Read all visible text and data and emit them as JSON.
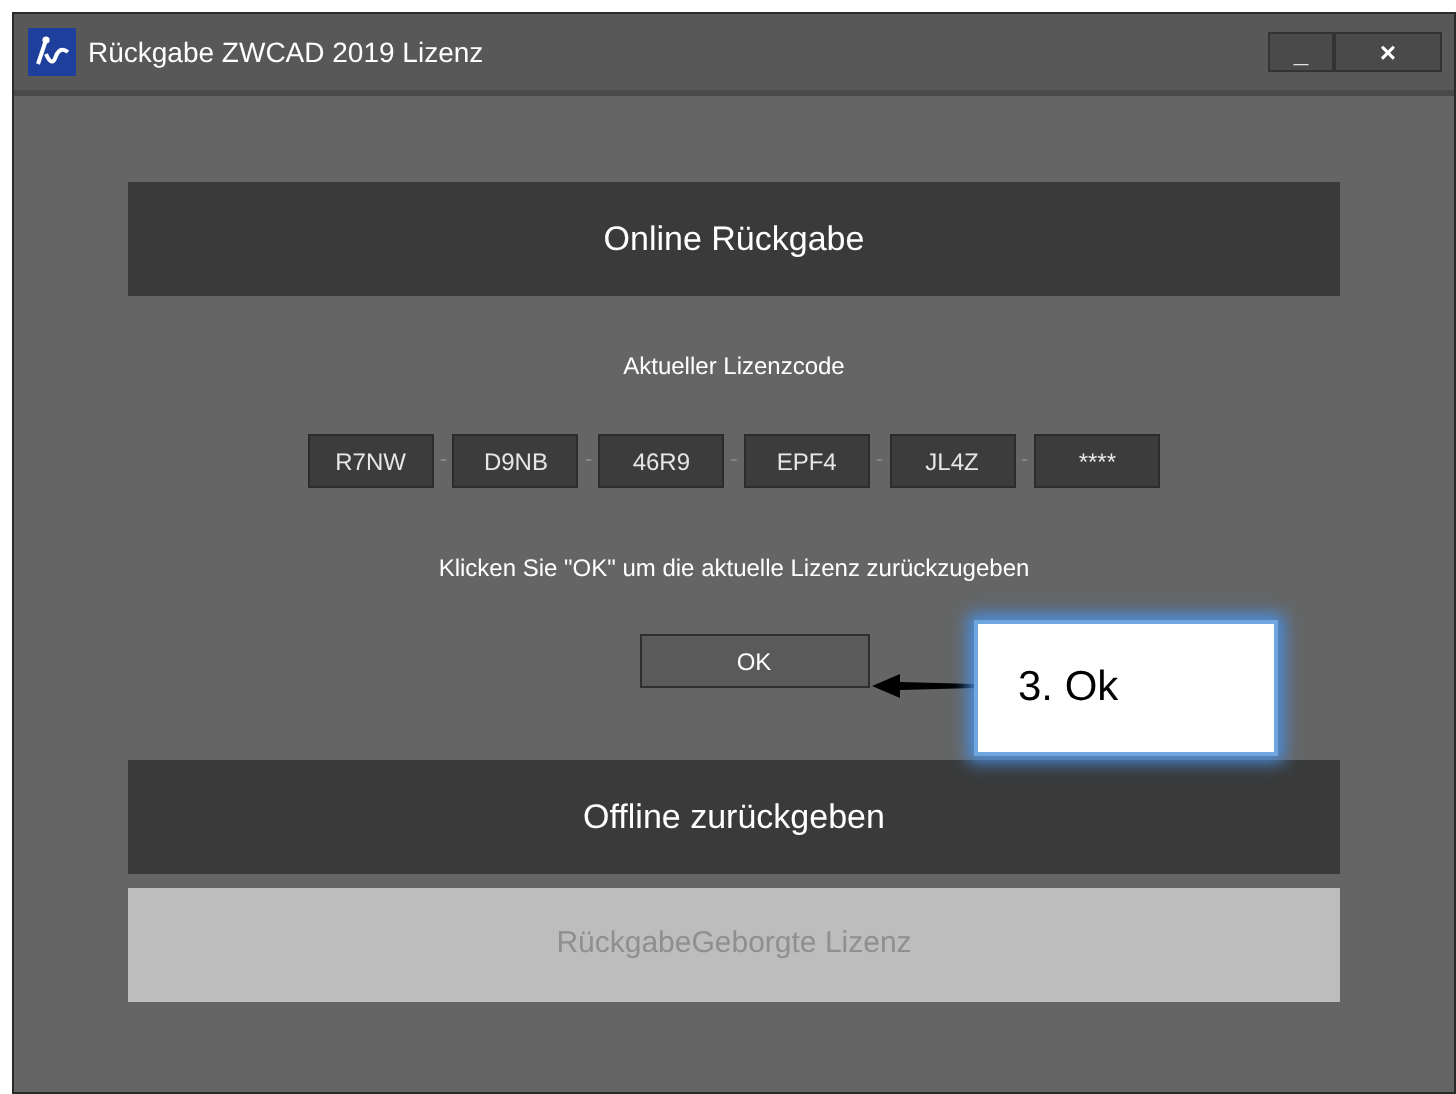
{
  "window": {
    "title": "Rückgabe ZWCAD 2019 Lizenz",
    "controls": [
      "_",
      "×"
    ]
  },
  "online_section": {
    "title": "Online Rückgabe",
    "code_label": "Aktueller Lizenzcode",
    "code_segments": [
      "R7NW",
      "D9NB",
      "46R9",
      "EPF4",
      "JL4Z",
      "****"
    ],
    "separator": "-",
    "instruction": "Klicken Sie \"OK\" um die aktuelle Lizenz zurückzugeben",
    "ok_button": "OK"
  },
  "offline_section": {
    "title": "Offline zurückgeben",
    "borrowed_button": {
      "label": "RückgabeGeborgte Lizenz",
      "disabled": true
    }
  },
  "callout": {
    "text": "3. Ok"
  }
}
